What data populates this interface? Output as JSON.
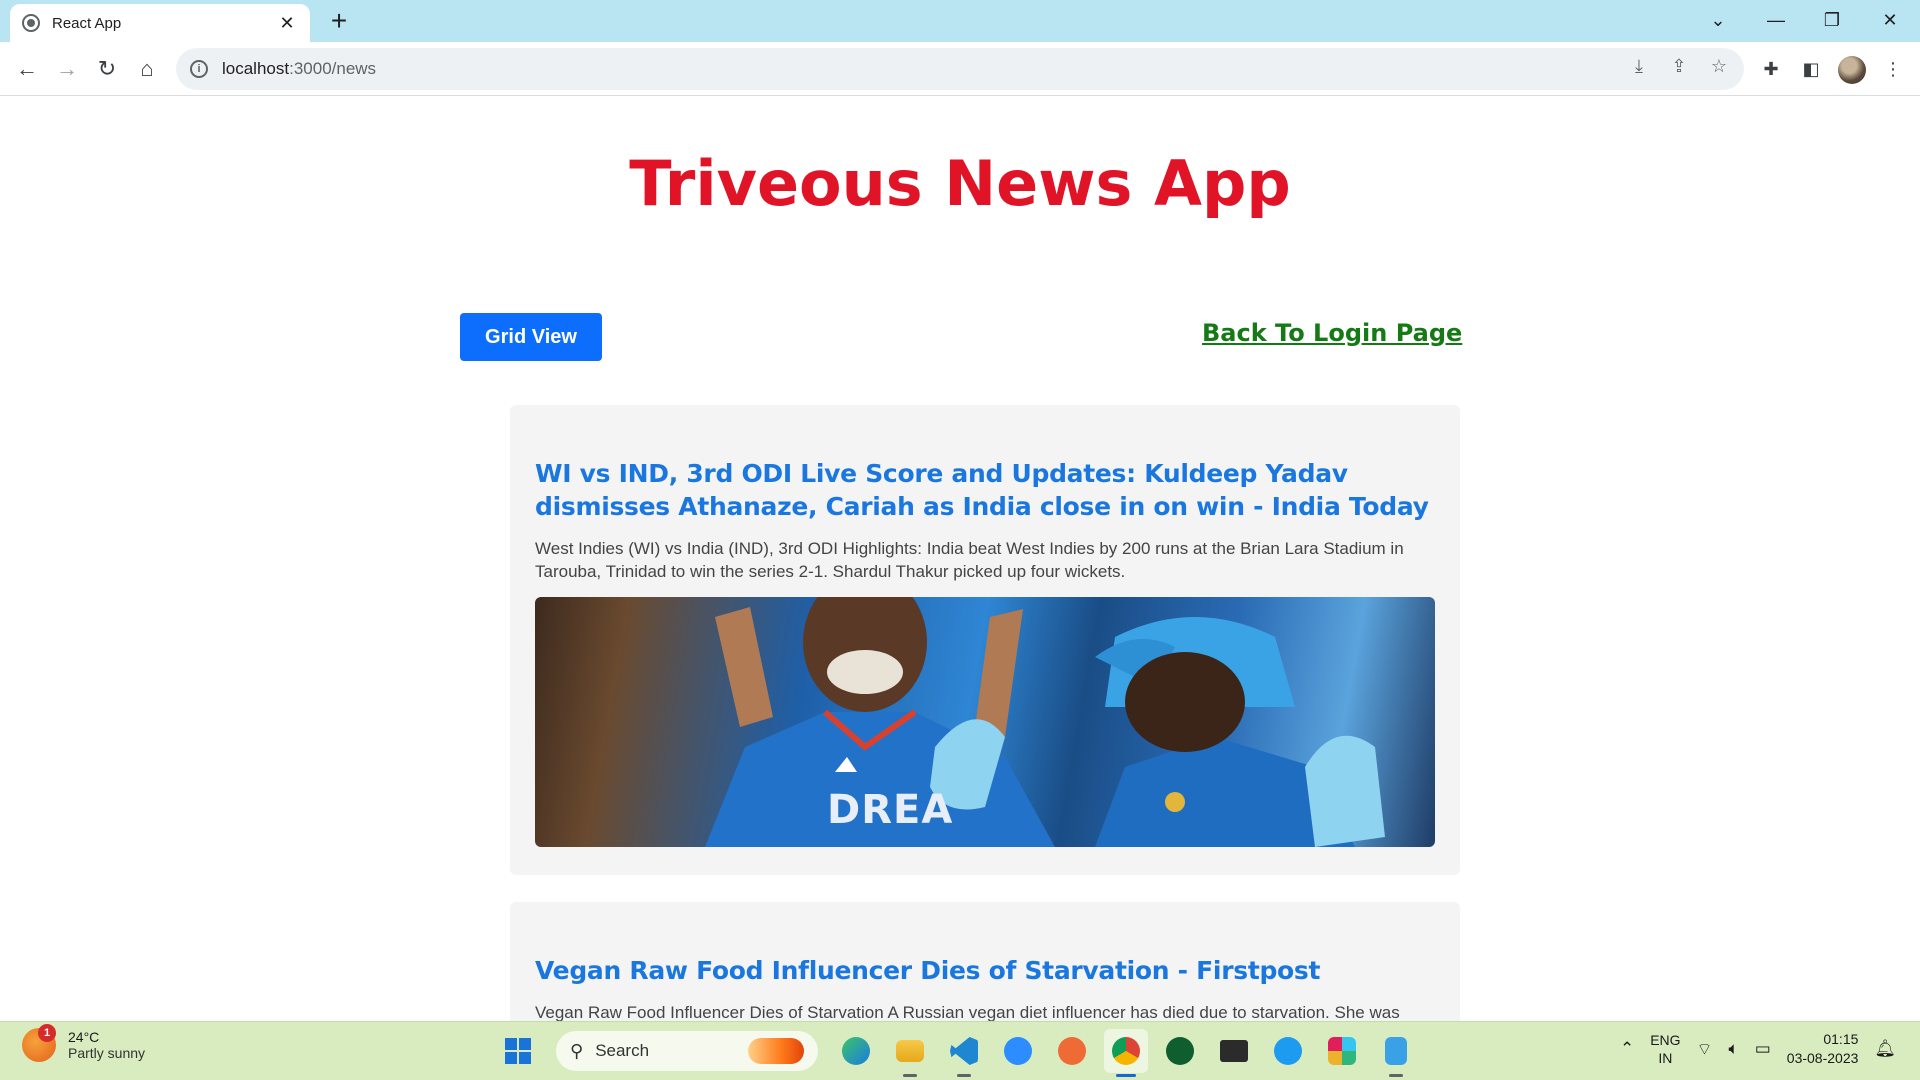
{
  "browser": {
    "tab_title": "React App",
    "url_host": "localhost",
    "url_path": ":3000/news",
    "close_glyph": "✕",
    "newtab_glyph": "+"
  },
  "page": {
    "title": "Triveous News App",
    "grid_button": "Grid View",
    "back_link": "Back To Login Page"
  },
  "articles": [
    {
      "title": "WI vs IND, 3rd ODI Live Score and Updates: Kuldeep Yadav dismisses Athanaze, Cariah as India close in on win - India Today",
      "description": "West Indies (WI) vs India (IND), 3rd ODI Highlights: India beat West Indies by 200 runs at the Brian Lara Stadium in Tarouba, Trinidad to win the series 2-1. Shardul Thakur picked up four wickets.",
      "image_text": "DREA"
    },
    {
      "title": "Vegan Raw Food Influencer Dies of Starvation - Firstpost",
      "description": "Vegan Raw Food Influencer Dies of Starvation A Russian vegan diet influencer has died due to starvation. She was"
    }
  ],
  "taskbar": {
    "weather_badge": "1",
    "temperature": "24°C",
    "weather_desc": "Partly sunny",
    "search_label": "Search",
    "lang_line1": "ENG",
    "lang_line2": "IN",
    "time": "01:15",
    "date": "03-08-2023"
  },
  "colors": {
    "title_red": "#e01327",
    "link_green": "#157a15",
    "button_blue": "#0d6efd",
    "article_title_blue": "#1a77e0"
  }
}
